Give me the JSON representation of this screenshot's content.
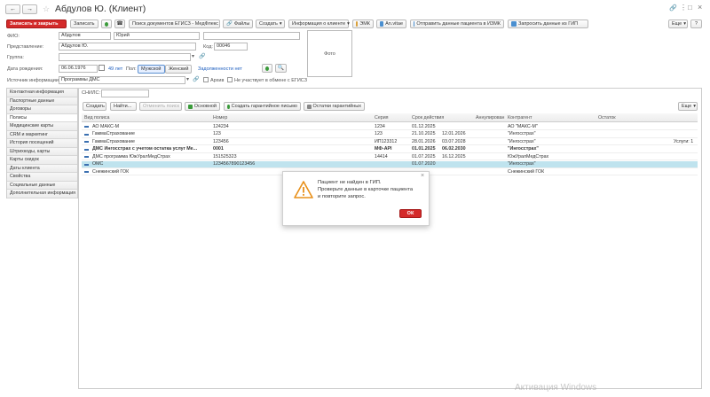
{
  "window": {
    "title": "Абдулов Ю. (Клиент)",
    "more_label": "⋮",
    "maximize_label": "□",
    "close_label": "×"
  },
  "toolbar": {
    "save_close": "Записать и закрыть",
    "save": "Записать",
    "egisz_search": "Поиск документов ЕГИСЗ - МедФлекс",
    "files": "Файлы",
    "create": "Создать",
    "client_info": "Информация о клиенте",
    "emk": "ЭМК",
    "an_vitae": "An.vitae",
    "send_izmk": "Отправить данные пациента в ИЗМК",
    "request_gip": "Запросить данные из ГИП",
    "more": "Еще",
    "help": "?"
  },
  "form": {
    "fio_label": "ФИО:",
    "surname": "Абдулов",
    "name": "Юрий",
    "patronymic": "",
    "representation_label": "Представление:",
    "representation": "Абдулов Ю.",
    "code_label": "Код:",
    "code": "00046",
    "group_label": "Группа:",
    "group": "",
    "birth_label": "Дата рождения:",
    "birth": "06.06.1976",
    "age": "49 лет",
    "sex_label": "Пол:",
    "sex_male": "Мужской",
    "sex_female": "Женский",
    "debt": "Задолженности нет",
    "source_label": "Источник информации:",
    "source": "Программы ДМС",
    "archive_label": "Архив",
    "no_egisz_label": "Не участвует в обмене с ЕГИСЗ",
    "photo_label": "Фото"
  },
  "sidebar": {
    "items": [
      {
        "label": "Контактная информация"
      },
      {
        "label": "Паспортные данные"
      },
      {
        "label": "Договоры"
      },
      {
        "label": "Полисы"
      },
      {
        "label": "Медицинские карты"
      },
      {
        "label": "CRM и маркетинг"
      },
      {
        "label": "История посещений"
      },
      {
        "label": "Штрихкоды, карты"
      },
      {
        "label": "Карты скидок"
      },
      {
        "label": "Даты клиента"
      },
      {
        "label": "Свойства"
      },
      {
        "label": "Социальные данные"
      },
      {
        "label": "Дополнительная информация"
      }
    ]
  },
  "policies": {
    "snils_label": "СНИЛС:",
    "snils": "",
    "create": "Создать",
    "find": "Найти...",
    "cancel_search": "Отменить поиск",
    "main": "Основной",
    "create_guarantee": "Создать гарантийное письмо",
    "guarantee_left": "Остатки гарантийных",
    "more": "Еще",
    "columns": [
      "Вид полиса",
      "Номер",
      "Серия",
      "Срок действия",
      "Аннулирован",
      "Контрагент",
      "Остаток"
    ],
    "rows": [
      {
        "type": "АО МАКС-М",
        "number": "124234",
        "series": "1234",
        "from": "01.12.2025",
        "to": "",
        "annulled": "",
        "contractor": "АО \"МАКС-М\"",
        "rest": ""
      },
      {
        "type": "ГаммаСтрахование",
        "number": "123",
        "series": "123",
        "from": "21.10.2025",
        "to": "12.01.2026",
        "annulled": "",
        "contractor": "\"Ингосстрах\"",
        "rest": ""
      },
      {
        "type": "ГаммаСтрахование",
        "number": "123456",
        "series": "ИП123312",
        "from": "28.01.2026",
        "to": "03.07.2028",
        "annulled": "",
        "contractor": "\"Ингосстрах\"",
        "rest": "Услуги: 1"
      },
      {
        "type": "ДМС Ингосстрах с учетом остатка услуг Ме...",
        "number": "0001",
        "series": "МФ-API",
        "from": "01.01.2025",
        "to": "06.02.2030",
        "annulled": "",
        "contractor": "\"Ингосстрах\"",
        "rest": ""
      },
      {
        "type": "ДМС программа ЮжУралМедСтрах",
        "number": "151525323",
        "series": "14414",
        "from": "01.07.2025",
        "to": "16.12.2025",
        "annulled": "",
        "contractor": "ЮжУралМедСтрах",
        "rest": ""
      },
      {
        "type": "ОМС",
        "number": "1234567890123456",
        "series": "",
        "from": "01.07.2020",
        "to": "",
        "annulled": "",
        "contractor": "\"Ингосстрах\"",
        "rest": ""
      },
      {
        "type": "Снежинский ГОК",
        "number": "",
        "series": "",
        "from": "",
        "to": "",
        "annulled": "",
        "contractor": "Снежинский ГОК",
        "rest": ""
      }
    ]
  },
  "dialog": {
    "message_line1": "Пациент не найден в ГИП.",
    "message_line2": "Проверьте данные в карточке пациента",
    "message_line3": "и повторите запрос.",
    "ok": "ОК",
    "close_label": "×"
  },
  "watermark": "Активация Windows",
  "colors": {
    "accent_red": "#d42a2a",
    "selection": "#bfe3ee",
    "link_blue": "#2060c0",
    "green": "#3a9a3a"
  }
}
